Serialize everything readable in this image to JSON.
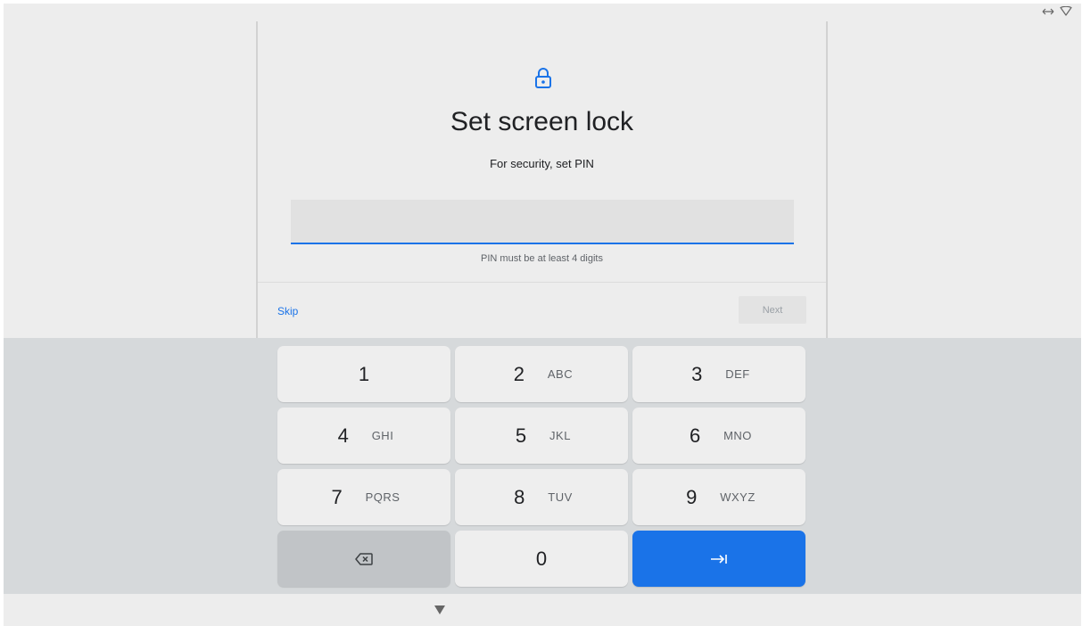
{
  "status_bar": {
    "icons": [
      "swap-horiz-icon",
      "wifi-icon"
    ]
  },
  "card": {
    "icon": "lock-icon",
    "title": "Set screen lock",
    "subtitle": "For security, set PIN",
    "pin_input": {
      "value": "",
      "placeholder": ""
    },
    "hint": "PIN must be at least 4 digits",
    "skip_label": "Skip",
    "next_label": "Next"
  },
  "keyboard": {
    "keys": [
      {
        "digit": "1",
        "letters": ""
      },
      {
        "digit": "2",
        "letters": "ABC"
      },
      {
        "digit": "3",
        "letters": "DEF"
      },
      {
        "digit": "4",
        "letters": "GHI"
      },
      {
        "digit": "5",
        "letters": "JKL"
      },
      {
        "digit": "6",
        "letters": "MNO"
      },
      {
        "digit": "7",
        "letters": "PQRS"
      },
      {
        "digit": "8",
        "letters": "TUV"
      },
      {
        "digit": "9",
        "letters": "WXYZ"
      },
      {
        "digit": "0",
        "letters": ""
      }
    ],
    "backspace_icon": "backspace-icon",
    "enter_icon": "tab-forward-icon"
  },
  "nav_bar": {
    "back_icon": "triangle-down-icon"
  },
  "colors": {
    "accent": "#1a73e8",
    "background": "#ededed",
    "keyboard_background": "#d6d9db",
    "key": "#eeeeee",
    "key_dark": "#c1c4c7"
  }
}
